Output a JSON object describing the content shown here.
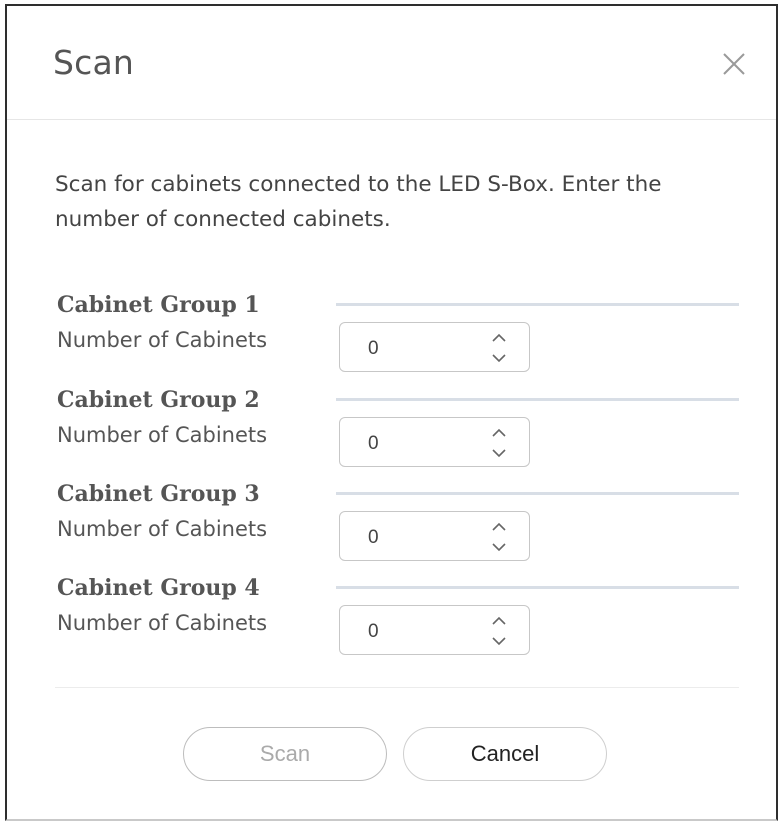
{
  "dialog": {
    "title": "Scan",
    "close_icon": "close-icon",
    "description": "Scan for cabinets connected to the LED S-Box. Enter the number of connected cabinets."
  },
  "groups": [
    {
      "title": "Cabinet Group 1",
      "field_label": "Number of Cabinets",
      "value": "0"
    },
    {
      "title": "Cabinet Group 2",
      "field_label": "Number of Cabinets",
      "value": "0"
    },
    {
      "title": "Cabinet Group 3",
      "field_label": "Number of Cabinets",
      "value": "0"
    },
    {
      "title": "Cabinet Group 4",
      "field_label": "Number of Cabinets",
      "value": "0"
    }
  ],
  "buttons": {
    "scan_label": "Scan",
    "cancel_label": "Cancel",
    "scan_enabled": false
  },
  "colors": {
    "border": "#2e2e2e",
    "divider": "#d8dee6",
    "disabled_text": "#aaaaaa"
  }
}
